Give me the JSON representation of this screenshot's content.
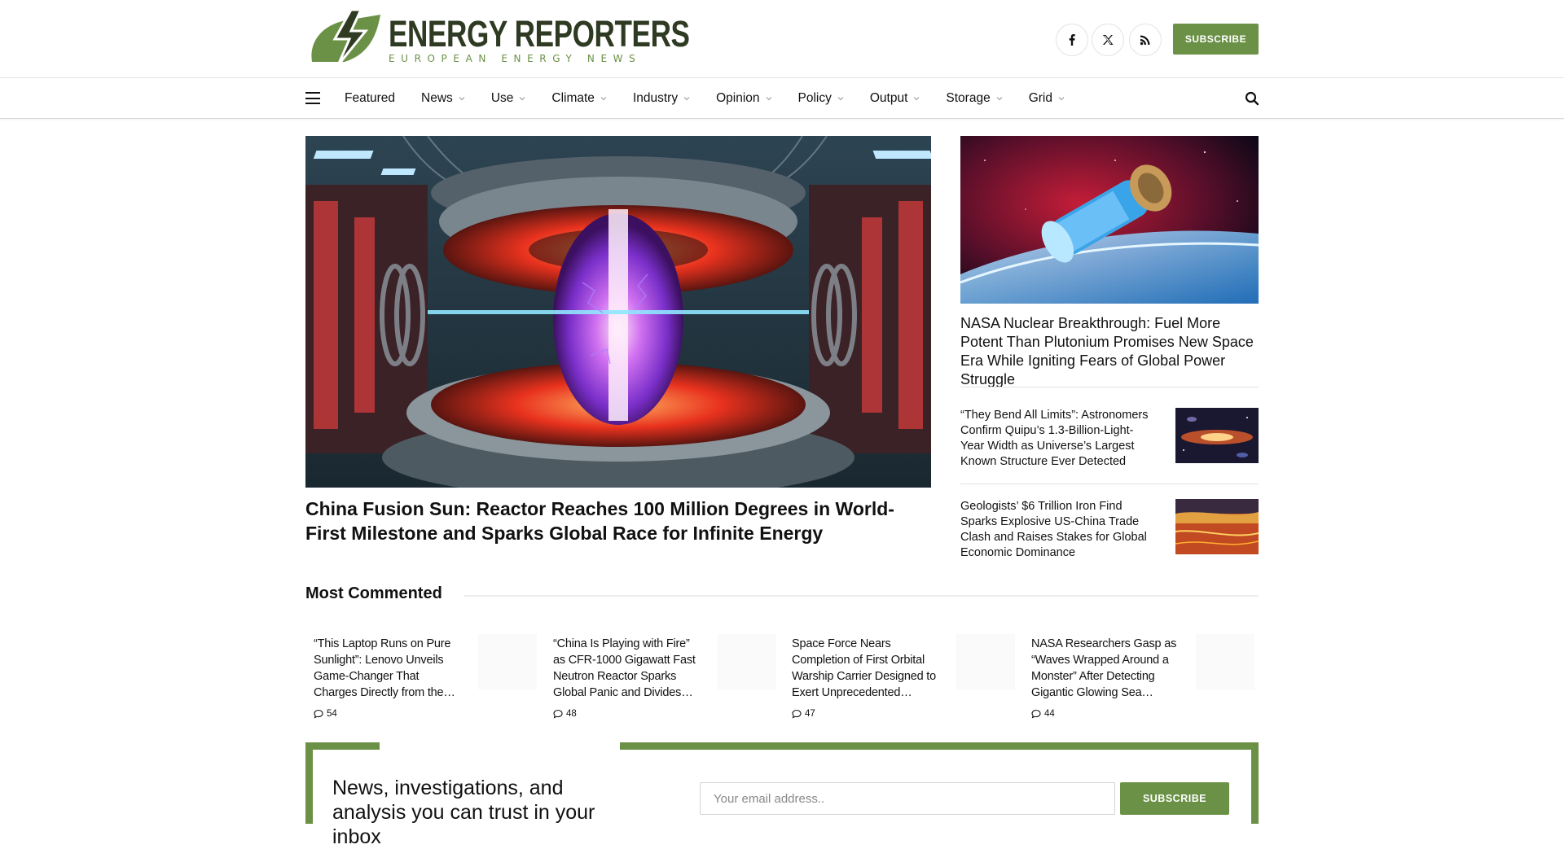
{
  "brand": {
    "title": "ENERGY REPORTERS",
    "subtitle": "EUROPEAN ENERGY NEWS",
    "accent_color": "#6b9146",
    "dark_color": "#2e3a22"
  },
  "header": {
    "social": [
      {
        "icon": "facebook-icon"
      },
      {
        "icon": "x-twitter-icon"
      },
      {
        "icon": "rss-icon"
      }
    ],
    "subscribe_label": "SUBSCRIBE"
  },
  "nav": {
    "items": [
      {
        "label": "Featured",
        "has_dropdown": false
      },
      {
        "label": "News",
        "has_dropdown": true
      },
      {
        "label": "Use",
        "has_dropdown": true
      },
      {
        "label": "Climate",
        "has_dropdown": true
      },
      {
        "label": "Industry",
        "has_dropdown": true
      },
      {
        "label": "Opinion",
        "has_dropdown": true
      },
      {
        "label": "Policy",
        "has_dropdown": true
      },
      {
        "label": "Output",
        "has_dropdown": true
      },
      {
        "label": "Storage",
        "has_dropdown": true
      },
      {
        "label": "Grid",
        "has_dropdown": true
      }
    ]
  },
  "hero": {
    "title": "China Fusion Sun: Reactor Reaches 100 Million Degrees in World-First Milestone and Sparks Global Race for Infinite Energy"
  },
  "sidebar": {
    "feature_title": "NASA Nuclear Breakthrough: Fuel More Potent Than Plutonium Promises New Space Era While Igniting Fears of Global Power Struggle",
    "stories": [
      {
        "title": "“They Bend All Limits”: Astronomers Confirm Quipu’s 1.3-Billion-Light-Year Width as Universe’s Largest Known Structure Ever Detected"
      },
      {
        "title": "Geologists’ $6 Trillion Iron Find Sparks Explosive US-China Trade Clash and Raises Stakes for Global Economic Dominance"
      }
    ]
  },
  "most_commented": {
    "heading": "Most Commented",
    "items": [
      {
        "title": "“This Laptop Runs on Pure Sunlight”: Lenovo Unveils Game-Changer That Charges Directly from the…",
        "comments": "54"
      },
      {
        "title": "“China Is Playing with Fire” as CFR-1000 Gigawatt Fast Neutron Reactor Sparks Global Panic and Divides…",
        "comments": "48"
      },
      {
        "title": "Space Force Nears Completion of First Orbital Warship Carrier Designed to Exert Unprecedented…",
        "comments": "47"
      },
      {
        "title": "NASA Researchers Gasp as “Waves Wrapped Around a Monster” After Detecting Gigantic Glowing Sea…",
        "comments": "44"
      }
    ]
  },
  "newsletter": {
    "heading": "News, investigations, and analysis you can trust in your inbox",
    "email_placeholder": "Your email address..",
    "button_label": "SUBSCRIBE"
  }
}
